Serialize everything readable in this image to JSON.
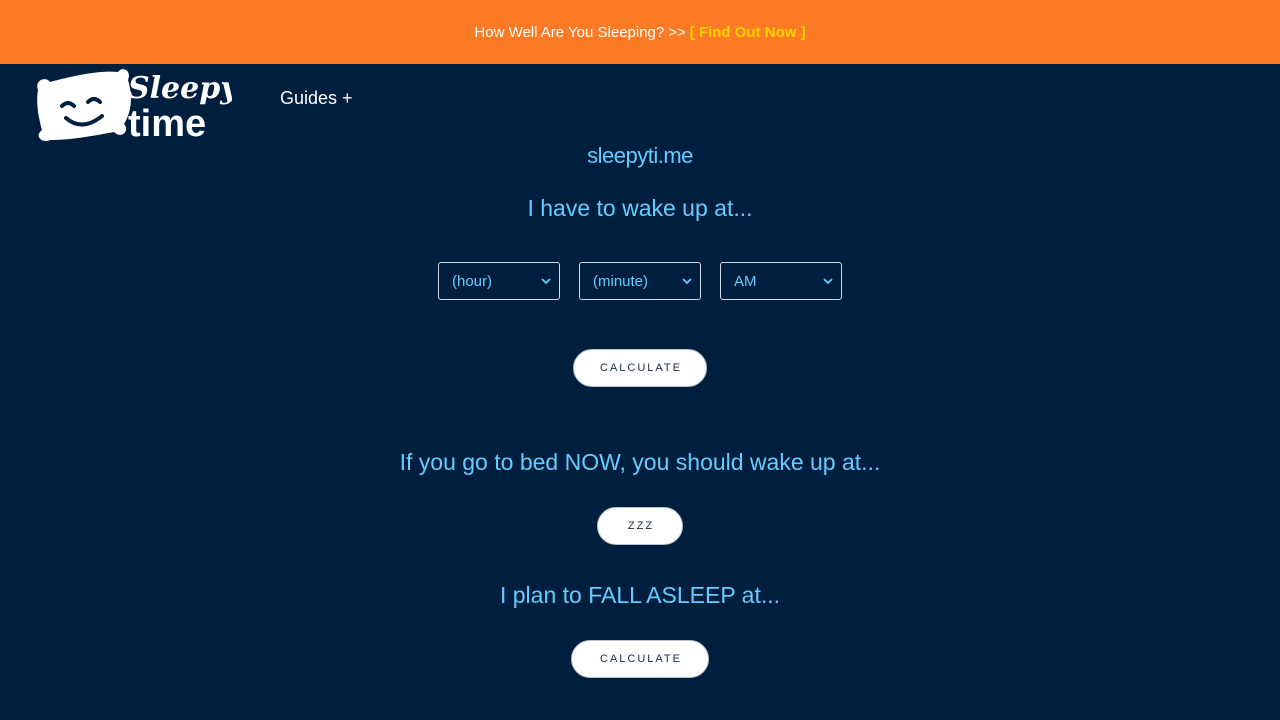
{
  "banner": {
    "question": "How Well Are You Sleeping?",
    "separator": ">>",
    "cta": "[ Find Out Now ]"
  },
  "logo": {
    "line1": "Sleepy",
    "line2": "time"
  },
  "nav": {
    "guides": "Guides +"
  },
  "site_name": "sleepyti.me",
  "wake_section": {
    "heading": "I have to wake up at...",
    "hour_select": "(hour)",
    "minute_select": "(minute)",
    "ampm_select": "AM",
    "button": "CALCULATE"
  },
  "now_section": {
    "heading": "If you go to bed NOW, you should wake up at...",
    "button": "ZZZ"
  },
  "asleep_section": {
    "heading": "I plan to FALL ASLEEP at...",
    "button": "CALCULATE"
  },
  "colors": {
    "background": "#001f3f",
    "banner": "#fd7a24",
    "accent_text": "#66ccff",
    "cta": "#ffd400"
  }
}
